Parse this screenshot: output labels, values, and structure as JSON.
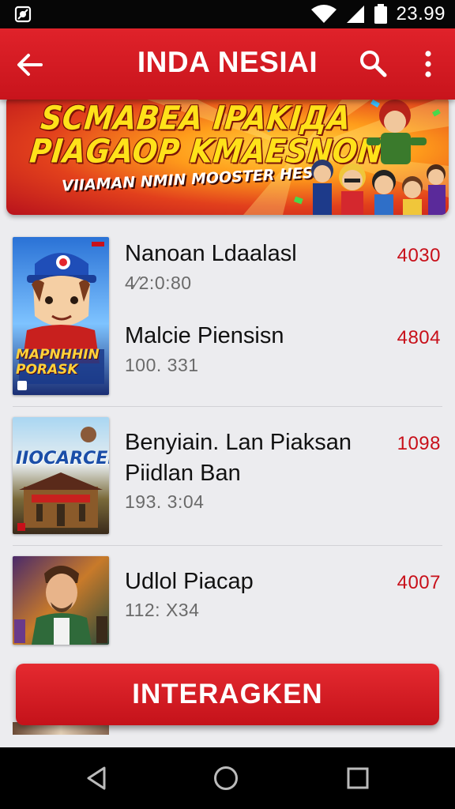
{
  "status_bar": {
    "time": "23.99"
  },
  "app_bar": {
    "title": "INDA NESIAI"
  },
  "banner": {
    "line1": "SCMABEA IPAKIДA",
    "line2": "PIAGAOP KMAESNON",
    "line3": "VIIAMAN NMIN MOOSTER HESR"
  },
  "list": [
    {
      "title": "Nanoan Ldaalasl",
      "subtitle": "4⁄2:0:80",
      "count": "4030",
      "thumb_caption": "MAPNHHIN PORASK"
    },
    {
      "title": "Malcie Piensisn",
      "subtitle": "100. 331",
      "count": "4804"
    },
    {
      "title": "Benyiain. Lan Piaksan",
      "title2": "Piidlan Ban",
      "subtitle": "193. 3:04",
      "count": "1098",
      "thumb_caption": "IIOCARCEM"
    },
    {
      "title": "Udlol Piacap",
      "subtitle": "112: X34",
      "count": "4007"
    }
  ],
  "cta": {
    "label": "INTERAGKEN"
  },
  "colors": {
    "accent": "#d41b22",
    "count": "#c8101a",
    "background": "#ececef"
  },
  "icons": [
    "app-icon",
    "wifi-icon",
    "signal-icon",
    "battery-icon",
    "back-arrow-icon",
    "search-icon",
    "more-vert-icon",
    "nav-back-icon",
    "nav-home-icon",
    "nav-recents-icon"
  ]
}
